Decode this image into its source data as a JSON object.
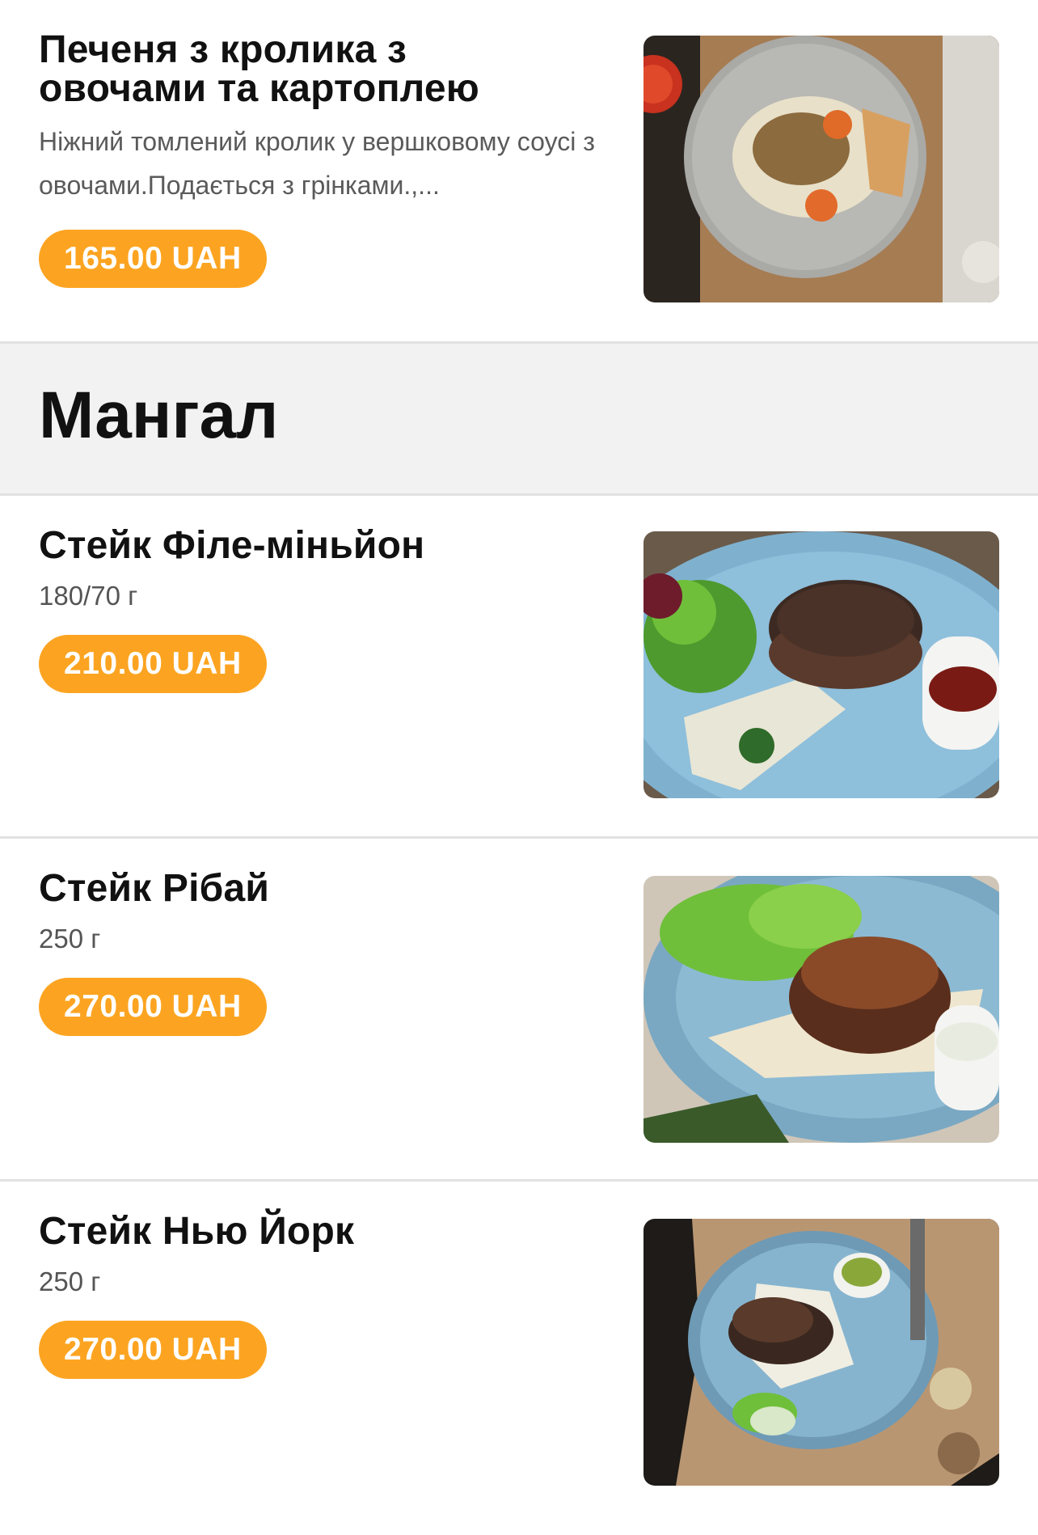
{
  "items_top": [
    {
      "title_line1": "Печеня з кролика з",
      "title_line2": "овочами та картоплею",
      "description": "Ніжний томлений кролик у вершковому соусі з овочами.Подається з грінками.,...",
      "price": "165.00 UAH"
    }
  ],
  "section": {
    "title": "Мангал"
  },
  "items": [
    {
      "title": "Стейк Філе-міньйон",
      "weight": "180/70 г",
      "price": "210.00 UAH"
    },
    {
      "title": "Стейк Рібай",
      "weight": "250 г",
      "price": "270.00 UAH"
    },
    {
      "title": "Стейк Нью Йорк",
      "weight": "250 г",
      "price": "270.00 UAH"
    }
  ],
  "colors": {
    "price_badge": "#fca421",
    "section_bg": "#f2f2f2",
    "divider": "#e2e2e2"
  }
}
